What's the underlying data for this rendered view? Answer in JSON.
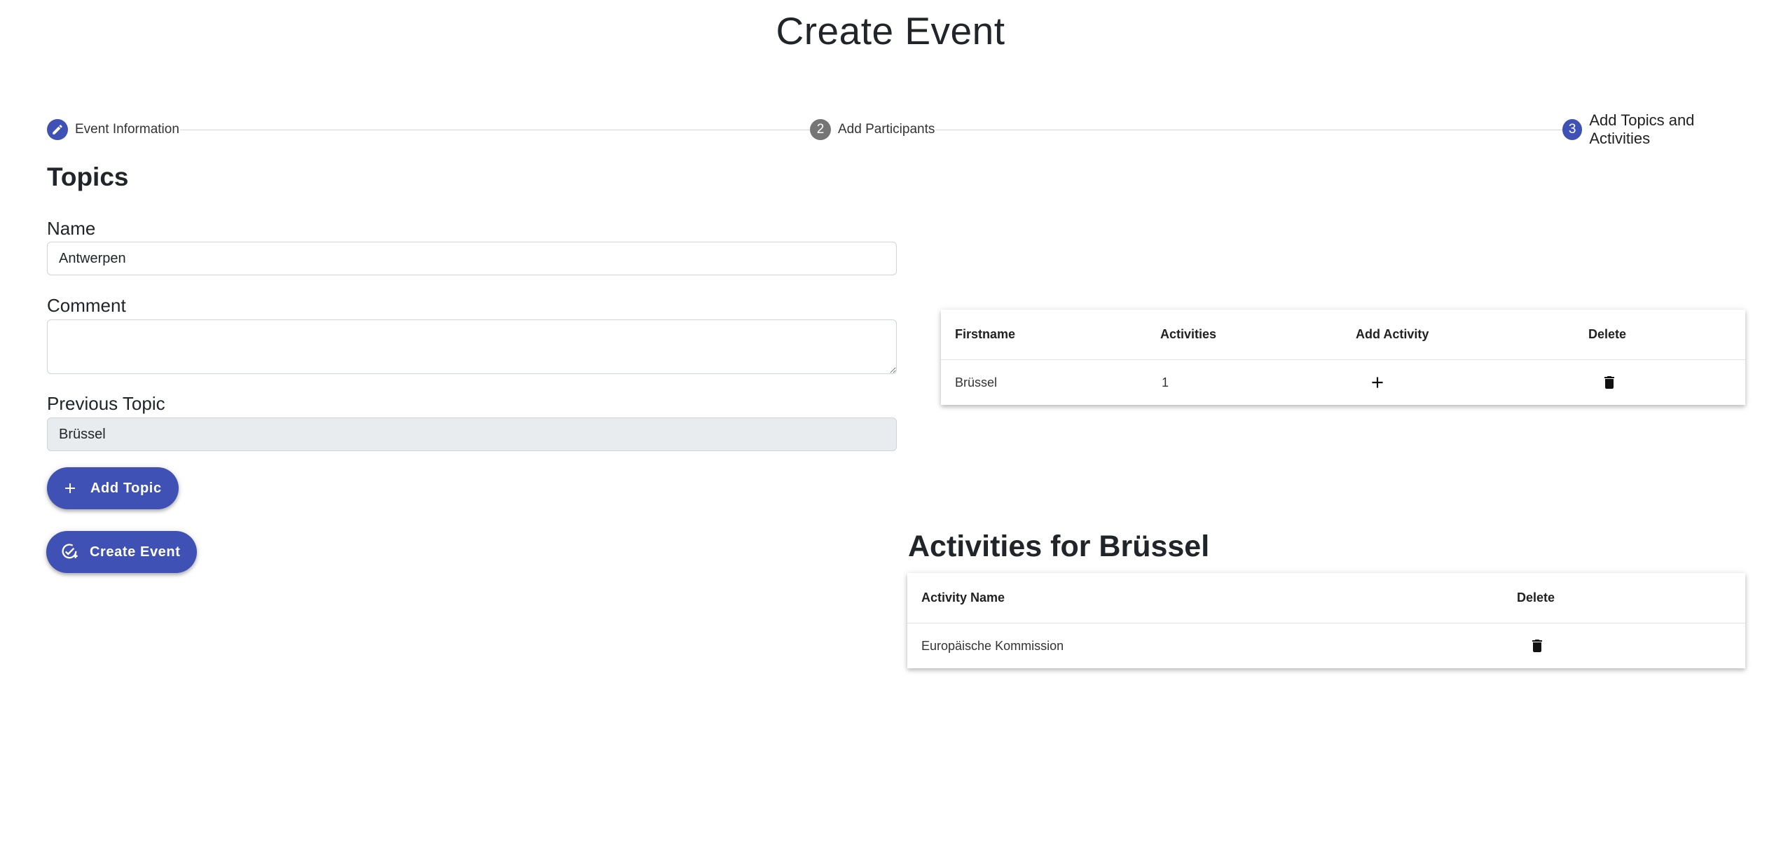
{
  "page": {
    "title": "Create Event"
  },
  "stepper": {
    "steps": [
      {
        "number": "",
        "label": "Event Information",
        "icon": "pencil-icon",
        "state": "completed"
      },
      {
        "number": "2",
        "label": "Add Participants",
        "state": "inactive"
      },
      {
        "number": "3",
        "label": "Add Topics and Activities",
        "state": "active"
      }
    ]
  },
  "topics": {
    "title": "Topics",
    "name_label": "Name",
    "name_value": "Antwerpen",
    "comment_label": "Comment",
    "comment_value": "",
    "previous_label": "Previous Topic",
    "previous_value": "Brüssel",
    "add_topic_label": "Add Topic",
    "create_event_label": "Create Event"
  },
  "topic_table": {
    "headers": [
      "Firstname",
      "Activities",
      "Add Activity",
      "Delete"
    ],
    "rows": [
      {
        "firstname": "Brüssel",
        "activities": "1"
      }
    ]
  },
  "activities": {
    "title": "Activities for Brüssel",
    "headers": [
      "Activity Name",
      "Delete"
    ],
    "rows": [
      {
        "name": "Europäische Kommission"
      }
    ]
  },
  "colors": {
    "primary": "#3f51b5",
    "inactive_step": "#757575",
    "disabled_input": "#e9ecef"
  }
}
